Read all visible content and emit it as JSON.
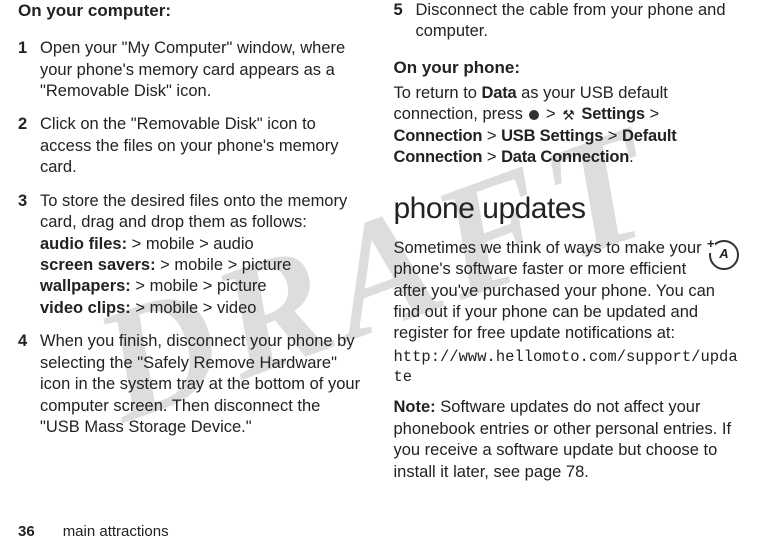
{
  "watermark": "DRAFT",
  "left": {
    "heading": "On your computer:",
    "steps": [
      {
        "n": "1",
        "text": "Open your \"My Computer\" window, where your phone's memory card appears as a \"Removable Disk\" icon."
      },
      {
        "n": "2",
        "text": "Click on the \"Removable Disk\" icon to access the files on your phone's memory card."
      },
      {
        "n": "3",
        "intro": "To store the desired files onto the memory card, drag and drop them as follows:",
        "lines": [
          {
            "label": "audio files:",
            "path": " > mobile > audio"
          },
          {
            "label": "screen savers:",
            "path": " > mobile > picture"
          },
          {
            "label": "wallpapers:",
            "path": " > mobile > picture"
          },
          {
            "label": "video clips:",
            "path": " > mobile > video"
          }
        ]
      },
      {
        "n": "4",
        "text": "When you finish, disconnect your phone by selecting the \"Safely Remove Hardware\" icon in the system tray at the bottom of your computer screen. Then disconnect the \"USB Mass Storage Device.\""
      }
    ]
  },
  "right": {
    "step5": {
      "n": "5",
      "text": "Disconnect the cable from your phone and computer."
    },
    "phone_heading": "On your phone:",
    "return_pre": "To return to ",
    "return_data": "Data",
    "return_mid": " as your USB default connection, press ",
    "gt": " > ",
    "settings": "Settings",
    "connection": "Connection",
    "usb": "USB Settings",
    "defconn": "Default Connection",
    "dataconn": "Data Connection",
    "period": ".",
    "section": "phone updates",
    "para1": "Sometimes we think of ways to make your phone's software faster or more efficient after you've purchased your phone. You can find out if your phone can be updated and register for free update notifications at:",
    "url": "http://www.hellomoto.com/support/update",
    "note_label": "Note:",
    "note_text": " Software updates do not affect your phonebook entries or other personal entries. If you receive a software update but choose to install it later, see page 78."
  },
  "footer": {
    "page": "36",
    "title": "main attractions"
  }
}
